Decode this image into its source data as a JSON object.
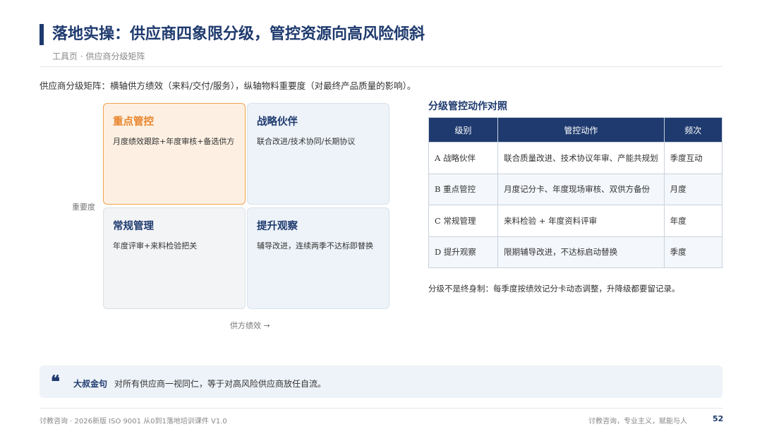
{
  "header": {
    "title": "落地实操：供应商四象限分级，管控资源向高风险倾斜",
    "subtitle": "工具页 · 供应商分级矩阵"
  },
  "intro": "供应商分级矩阵：横轴供方绩效（来料/交付/服务），纵轴物料重要度（对最终产品质量的影响）。",
  "matrix": {
    "y_axis": "重要度",
    "x_axis": "供方绩效 →",
    "quadrants": [
      {
        "title": "重点管控",
        "desc": "月度绩效跟踪+年度审核+备选供方"
      },
      {
        "title": "战略伙伴",
        "desc": "联合改进/技术协同/长期协议"
      },
      {
        "title": "常规管理",
        "desc": "年度评审+来料检验把关"
      },
      {
        "title": "提升观察",
        "desc": "辅导改进，连续两季不达标即替换"
      }
    ]
  },
  "table": {
    "title": "分级管控动作对照",
    "headers": [
      "级别",
      "管控动作",
      "频次"
    ],
    "rows": [
      [
        "A 战略伙伴",
        "联合质量改进、技术协议年审、产能共规划",
        "季度互动"
      ],
      [
        "B 重点管控",
        "月度记分卡、年度现场审核、双供方备份",
        "月度"
      ],
      [
        "C 常规管理",
        "来料检验 + 年度资料评审",
        "年度"
      ],
      [
        "D 提升观察",
        "限期辅导改进，不达标启动替换",
        "季度"
      ]
    ]
  },
  "note": "分级不是终身制：每季度按绩效记分卡动态调整，升降级都要留记录。",
  "quote": {
    "mark": "❝",
    "label": "大叔金句",
    "text": "对所有供应商一视同仁，等于对高风险供应商放任自流。"
  },
  "footer": {
    "left": "讨教咨询 · 2026新版 ISO 9001 从0到1落地培训课件 V1.0",
    "right": "讨教咨询，专业主义，赋能与人",
    "page": "52"
  },
  "colors": {
    "primary": "#1e3a6e",
    "accent": "#e8832a",
    "accent_bg": "#fdf0e2",
    "light_bg": "#eef3f9"
  }
}
